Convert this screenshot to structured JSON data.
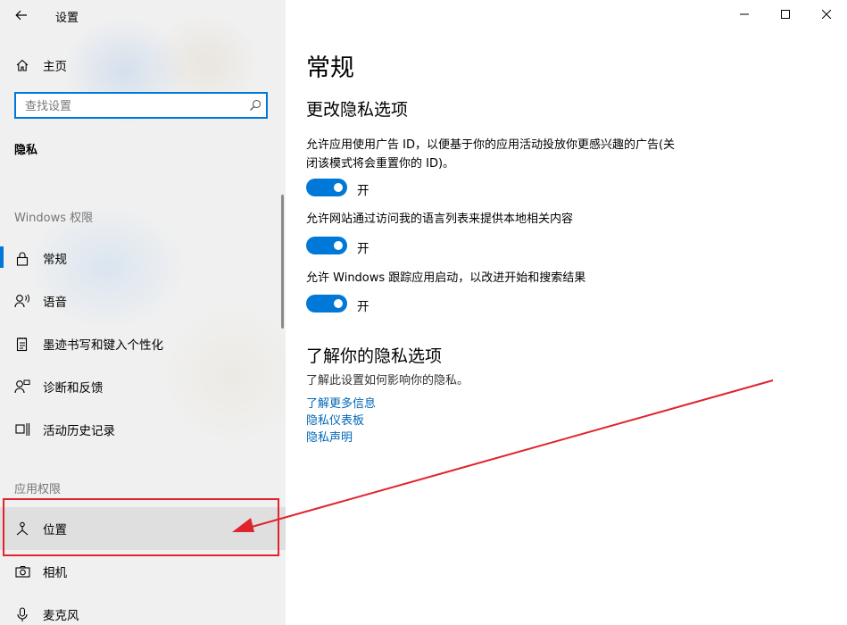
{
  "window": {
    "title": "设置",
    "controls": [
      "minimize-icon",
      "maximize-icon",
      "close-icon"
    ]
  },
  "sidebar": {
    "home_label": "主页",
    "search_placeholder": "查找设置",
    "section_current": "隐私",
    "group_windows": "Windows 权限",
    "group_app": "应用权限",
    "items": [
      {
        "label": "常规",
        "icon": "lock-icon",
        "selected": true
      },
      {
        "label": "语音",
        "icon": "speech-icon"
      },
      {
        "label": "墨迹书写和键入个性化",
        "icon": "notepad-icon"
      },
      {
        "label": "诊断和反馈",
        "icon": "feedback-person-icon"
      },
      {
        "label": "活动历史记录",
        "icon": "timeline-icon"
      },
      {
        "label": "位置",
        "icon": "location-icon",
        "highlighted": true
      },
      {
        "label": "相机",
        "icon": "camera-icon"
      },
      {
        "label": "麦克风",
        "icon": "microphone-icon"
      }
    ]
  },
  "main": {
    "title": "常规",
    "section1_heading": "更改隐私选项",
    "options": [
      {
        "desc_line1": "允许应用使用广告 ID，以便基于你的应用活动投放你更感兴趣的广告(关",
        "desc_line2": "闭该模式将会重置你的 ID)。",
        "state": "开",
        "on": true
      },
      {
        "desc_line1": "允许网站通过访问我的语言列表来提供本地相关内容",
        "state": "开",
        "on": true
      },
      {
        "desc_line1": "允许 Windows 跟踪应用启动，以改进开始和搜索结果",
        "state": "开",
        "on": true
      }
    ],
    "section2_heading": "了解你的隐私选项",
    "section2_desc": "了解此设置如何影响你的隐私。",
    "links": [
      "了解更多信息",
      "隐私仪表板",
      "隐私声明"
    ]
  },
  "colors": {
    "accent": "#0078d7",
    "link": "#0067b8",
    "annotation": "#e0242d"
  }
}
